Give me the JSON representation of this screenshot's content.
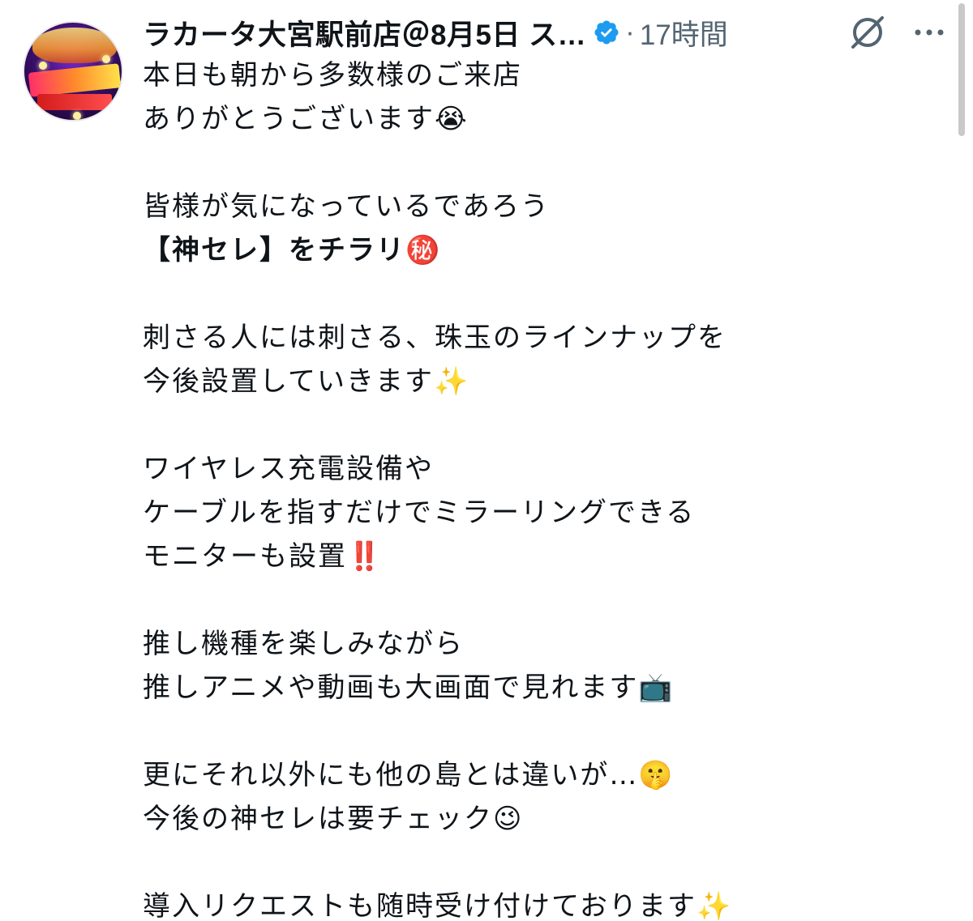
{
  "tweet": {
    "author_name": "ラカータ大宮駅前店＠8月5日 ス…",
    "separator": "·",
    "timestamp": "17時間",
    "lines": [
      "本日も朝から多数様のご来店",
      "ありがとうございます😭",
      "",
      "皆様が気になっているであろう",
      "【神セレ】をチラリ㊙️",
      "",
      "刺さる人には刺さる、珠玉のラインナップを",
      "今後設置していきます✨",
      "",
      "ワイヤレス充電設備や",
      "ケーブルを指すだけでミラーリングできる",
      "モニターも設置‼️",
      "",
      "推し機種を楽しみながら",
      "推しアニメや動画も大画面で見れます📺",
      "",
      "更にそれ以外にも他の島とは違いが…🤫",
      "今後の神セレは要チェック😉",
      "",
      "導入リクエストも随時受け付けております✨"
    ]
  },
  "icons": {
    "avatar": "store-avatar-image",
    "verified": "verified-badge-icon",
    "grok": "grok-icon",
    "more": "more-options-icon"
  },
  "colors": {
    "text": "#0f1419",
    "secondary": "#536471",
    "verified_blue": "#1d9bf0"
  }
}
